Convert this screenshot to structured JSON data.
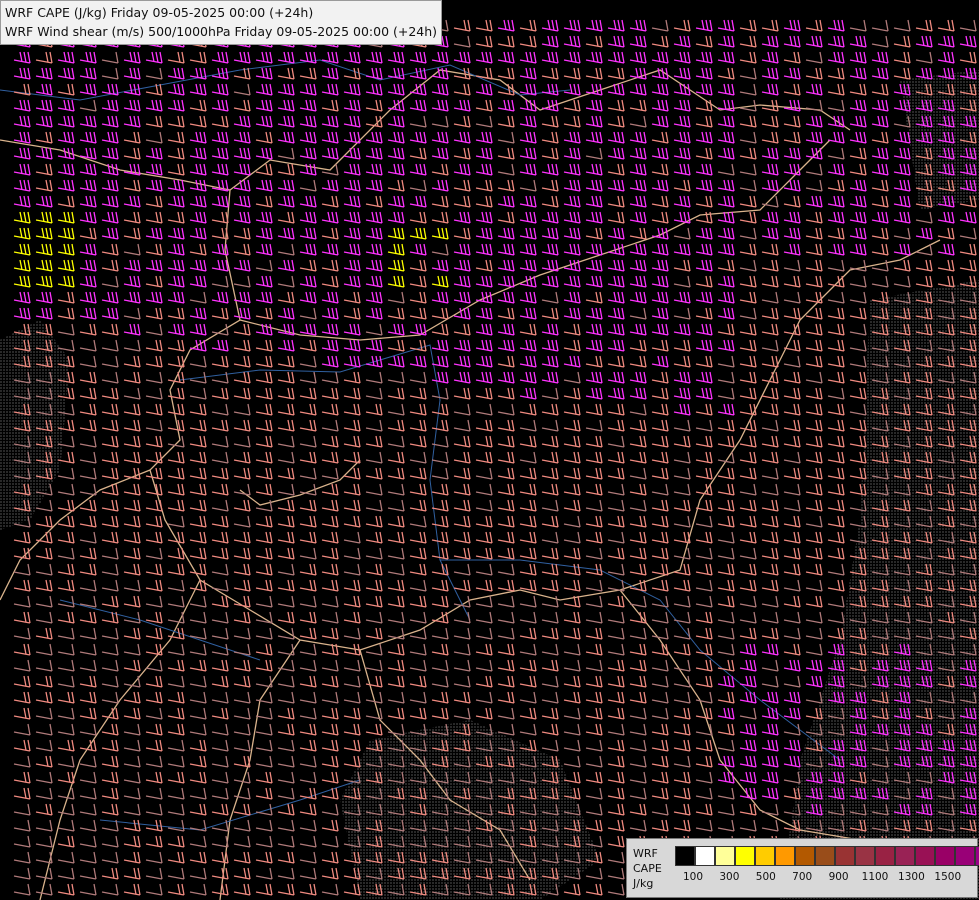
{
  "header": {
    "line1": "WRF CAPE (J/kg) Friday 09-05-2025 00:00 (+24h)",
    "line2": "WRF Wind shear (m/s) 500/1000hPa Friday 09-05-2025 00:00 (+24h)"
  },
  "legend": {
    "model": "WRF",
    "field": "CAPE",
    "unit": "J/kg",
    "tick_labels": [
      "100",
      "300",
      "500",
      "700",
      "900",
      "1100",
      "1300",
      "1500"
    ],
    "colors": [
      "#000000",
      "#ffffff",
      "#ffff99",
      "#ffff00",
      "#ffcc00",
      "#ff9900",
      "#b35900",
      "#994d1a",
      "#993333",
      "#993344",
      "#992244",
      "#992255",
      "#991155",
      "#990066",
      "#990077",
      "#990088",
      "#990099"
    ]
  },
  "barb_colors": {
    "weak": "#b07a7a",
    "moderate": "#f08a80",
    "strong": "#ff33ff",
    "very_strong": "#ffff00"
  },
  "map_colors": {
    "borders": "#d9b38c",
    "rivers": "#3060a0",
    "terrain": "#8c8c8c"
  }
}
